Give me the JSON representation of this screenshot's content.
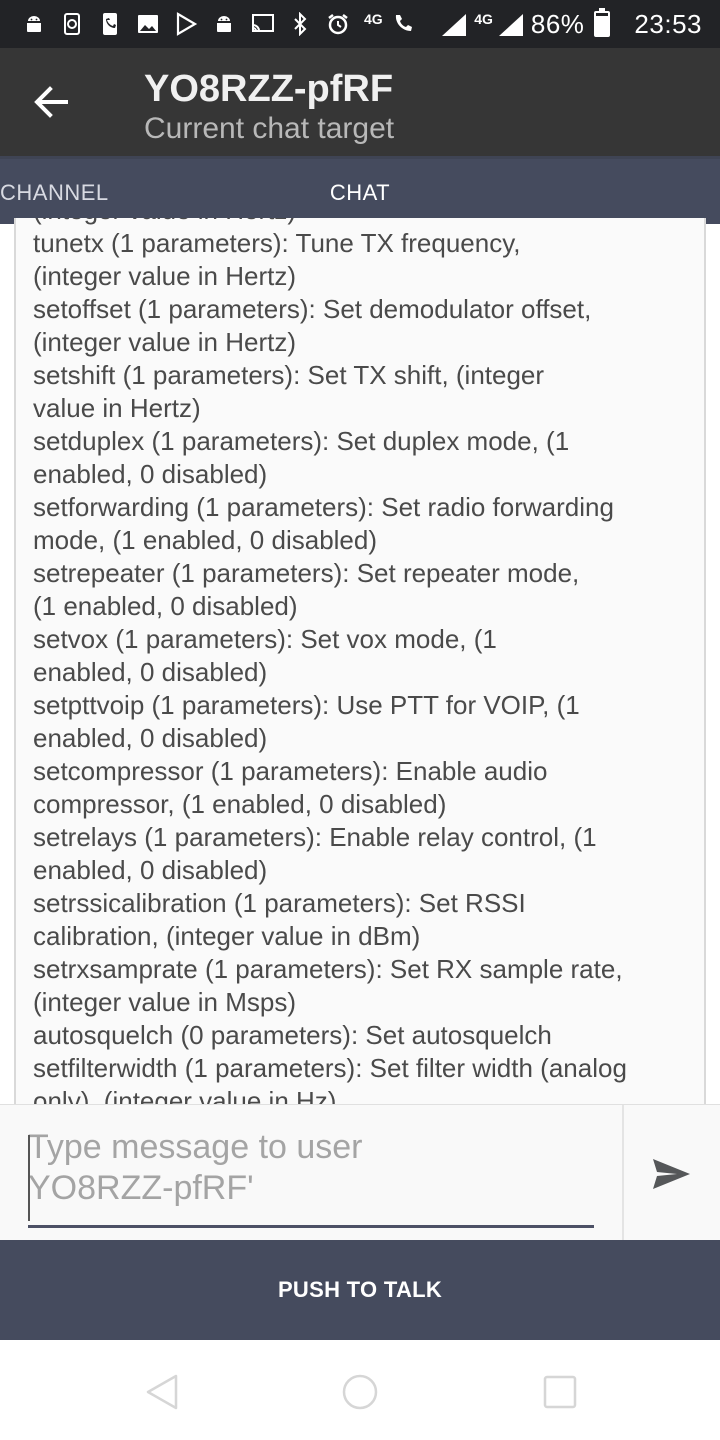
{
  "status_bar": {
    "network_badge_1": "4G",
    "network_badge_2": "4G",
    "battery_percent": "86%",
    "time": "23:53",
    "icons": [
      "android-icon",
      "sync-icon",
      "phone-icon",
      "image-icon",
      "play-store-icon",
      "android-icon",
      "cast-icon",
      "bluetooth-icon",
      "alarm-icon",
      "volte-call-icon",
      "signal-icon",
      "signal-icon",
      "battery-icon"
    ]
  },
  "app_bar": {
    "title": "YO8RZZ-pfRF",
    "subtitle": "Current chat target"
  },
  "tabs": [
    {
      "label": "CHANNEL",
      "selected": false
    },
    {
      "label": "CHAT",
      "selected": true
    }
  ],
  "log": {
    "lines": [
      "(integer value in Hertz)",
      "tunetx (1 parameters): Tune TX frequency,",
      "(integer value in Hertz)",
      "setoffset (1 parameters): Set demodulator offset,",
      "(integer value in Hertz)",
      "setshift (1 parameters): Set TX shift, (integer",
      "value in Hertz)",
      "setduplex (1 parameters): Set duplex mode, (1",
      "enabled, 0 disabled)",
      "setforwarding (1 parameters): Set radio forwarding",
      "mode, (1 enabled, 0 disabled)",
      "setrepeater (1 parameters): Set repeater mode,",
      "(1 enabled, 0 disabled)",
      "setvox (1 parameters): Set vox mode, (1",
      "enabled, 0 disabled)",
      "setpttvoip (1 parameters): Use PTT for VOIP, (1",
      "enabled, 0 disabled)",
      "setcompressor (1 parameters): Enable audio",
      "compressor, (1 enabled, 0 disabled)",
      "setrelays (1 parameters): Enable relay control, (1",
      "enabled, 0 disabled)",
      "setrssicalibration (1 parameters): Set RSSI",
      "calibration, (integer value in dBm)",
      "setrxsamprate (1 parameters): Set RX sample rate,",
      "(integer value in Msps)",
      "autosquelch (0 parameters): Set autosquelch",
      "setfilterwidth (1 parameters): Set filter width (analog",
      "only), (integer value in Hz)"
    ]
  },
  "compose": {
    "placeholder": "Type message to user\nYO8RZZ-pfRF'",
    "value": ""
  },
  "ptt": {
    "label": "PUSH TO TALK"
  },
  "colors": {
    "status_bar": "#222326",
    "app_bar": "#363636",
    "tabs_bg": "#454b5e",
    "ptt_bg": "#454b5e",
    "log_text": "#4a4a4a"
  }
}
